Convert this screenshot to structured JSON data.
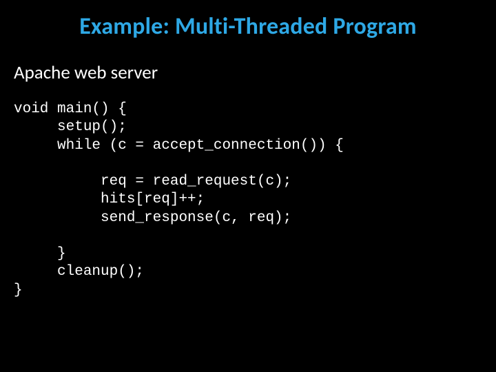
{
  "slide": {
    "title": "Example: Multi-Threaded Program",
    "subtitle": "Apache web server",
    "code": "void main() {\n     setup();\n     while (c = accept_connection()) {\n\n          req = read_request(c);\n          hits[req]++;\n          send_response(c, req);\n\n     }\n     cleanup();\n}"
  }
}
